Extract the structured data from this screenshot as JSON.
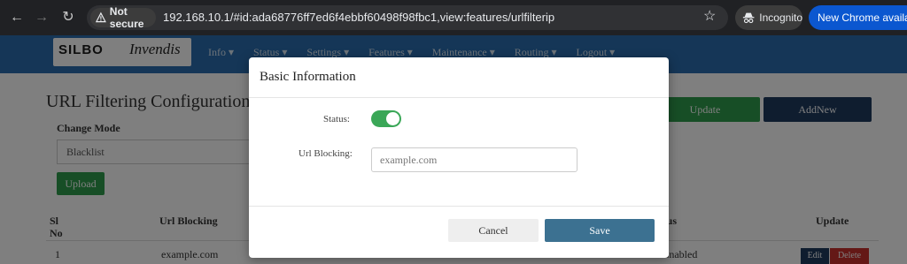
{
  "browser": {
    "back_icon": "arrow-left-icon",
    "forward_icon": "arrow-right-icon",
    "reload_icon": "reload-icon",
    "security_label": "Not secure",
    "url": "192.168.10.1/#id:ada68776ff7ed6f4ebbf60498f98fbc1,view:features/urlfilterip",
    "bookmark_icon": "star-icon",
    "incognito_label": "Incognito",
    "update_label": "New Chrome available"
  },
  "app": {
    "logo_brand": "SILBO",
    "logo_company": "Invendis",
    "nav_items": [
      "Info ▾",
      "Status ▾",
      "Settings ▾",
      "Features ▾",
      "Maintenance ▾",
      "Routing ▾",
      "Logout ▾"
    ],
    "nav_color": "#2a6cae"
  },
  "page": {
    "title": "URL Filtering Configuration",
    "change_mode_label": "Change Mode",
    "mode_value": "Blacklist",
    "upload_label": "Upload",
    "update_label": "Update",
    "addnew_label": "AddNew",
    "table": {
      "headers": {
        "sl": "Sl No",
        "url": "Url Blocking",
        "status": "Status",
        "update": "Update"
      },
      "rows": [
        {
          "sl": "1",
          "url": "example.com",
          "status": "Enabled",
          "edit": "Edit",
          "delete": "Delete"
        }
      ]
    }
  },
  "modal": {
    "title": "Basic Information",
    "status_label": "Status:",
    "status_enabled": true,
    "url_label": "Url Blocking:",
    "url_value": "",
    "url_placeholder": "example.com",
    "cancel_label": "Cancel",
    "save_label": "Save",
    "toggle_color": "#3aa757",
    "save_color": "#3c7191"
  }
}
